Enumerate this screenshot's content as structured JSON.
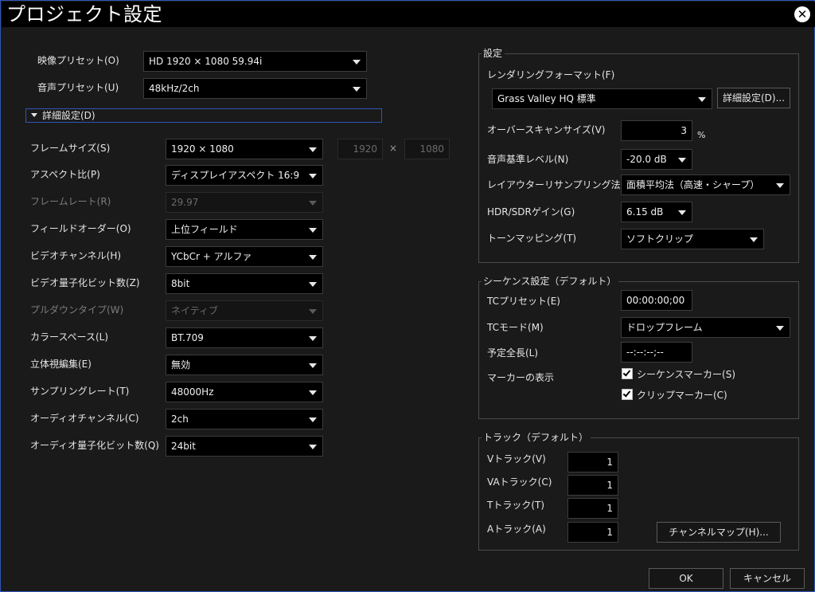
{
  "window": {
    "title": "プロジェクト設定"
  },
  "left": {
    "video_preset": {
      "label": "映像プリセット(O)",
      "value": "HD 1920 × 1080 59.94i"
    },
    "audio_preset": {
      "label": "音声プリセット(U)",
      "value": "48kHz/2ch"
    },
    "detail_toggle": "詳細設定(D)",
    "frame_size": {
      "label": "フレームサイズ(S)",
      "value": "1920 × 1080",
      "width": "1920",
      "height": "1080",
      "times": "×"
    },
    "aspect": {
      "label": "アスペクト比(P)",
      "value": "ディスプレイアスペクト 16:9"
    },
    "frame_rate": {
      "label": "フレームレート(R)",
      "value": "29.97"
    },
    "field_order": {
      "label": "フィールドオーダー(O)",
      "value": "上位フィールド"
    },
    "video_channel": {
      "label": "ビデオチャンネル(H)",
      "value": "YCbCr + アルファ"
    },
    "video_bits": {
      "label": "ビデオ量子化ビット数(Z)",
      "value": "8bit"
    },
    "pulldown": {
      "label": "プルダウンタイプ(W)",
      "value": "ネイティブ"
    },
    "color_space": {
      "label": "カラースペース(L)",
      "value": "BT.709"
    },
    "stereo": {
      "label": "立体視編集(E)",
      "value": "無効"
    },
    "sampling_rate": {
      "label": "サンプリングレート(T)",
      "value": "48000Hz"
    },
    "audio_channel": {
      "label": "オーディオチャンネル(C)",
      "value": "2ch"
    },
    "audio_bits": {
      "label": "オーディオ量子化ビット数(Q)",
      "value": "24bit"
    }
  },
  "settings": {
    "legend": "設定",
    "render_format": {
      "label": "レンダリングフォーマット(F)",
      "value": "Grass Valley HQ 標準",
      "detail_button": "詳細設定(D)..."
    },
    "overscan": {
      "label": "オーバースキャンサイズ(V)",
      "value": "3",
      "unit": "%"
    },
    "audio_ref": {
      "label": "音声基準レベル(N)",
      "value": "-20.0 dB"
    },
    "layouter": {
      "label": "レイアウターリサンプリング法(R)",
      "value": "面積平均法（高速・シャープ）"
    },
    "hdr_gain": {
      "label": "HDR/SDRゲイン(G)",
      "value": "6.15 dB"
    },
    "tone_mapping": {
      "label": "トーンマッピング(T)",
      "value": "ソフトクリップ"
    }
  },
  "sequence": {
    "legend": "シーケンス設定（デフォルト）",
    "tc_preset": {
      "label": "TCプリセット(E)",
      "value": "00:00:00;00"
    },
    "tc_mode": {
      "label": "TCモード(M)",
      "value": "ドロップフレーム"
    },
    "length": {
      "label": "予定全長(L)",
      "value": "--:--:--;--"
    },
    "markers": {
      "label": "マーカーの表示",
      "sequence_marker": {
        "label": "シーケンスマーカー(S)",
        "checked": true
      },
      "clip_marker": {
        "label": "クリップマーカー(C)",
        "checked": true
      }
    }
  },
  "tracks": {
    "legend": "トラック（デフォルト）",
    "v": {
      "label": "Vトラック(V)",
      "value": "1"
    },
    "va": {
      "label": "VAトラック(C)",
      "value": "1"
    },
    "t": {
      "label": "Tトラック(T)",
      "value": "1"
    },
    "a": {
      "label": "Aトラック(A)",
      "value": "1"
    },
    "channel_map_button": "チャンネルマップ(H)..."
  },
  "footer": {
    "ok": "OK",
    "cancel": "キャンセル"
  }
}
